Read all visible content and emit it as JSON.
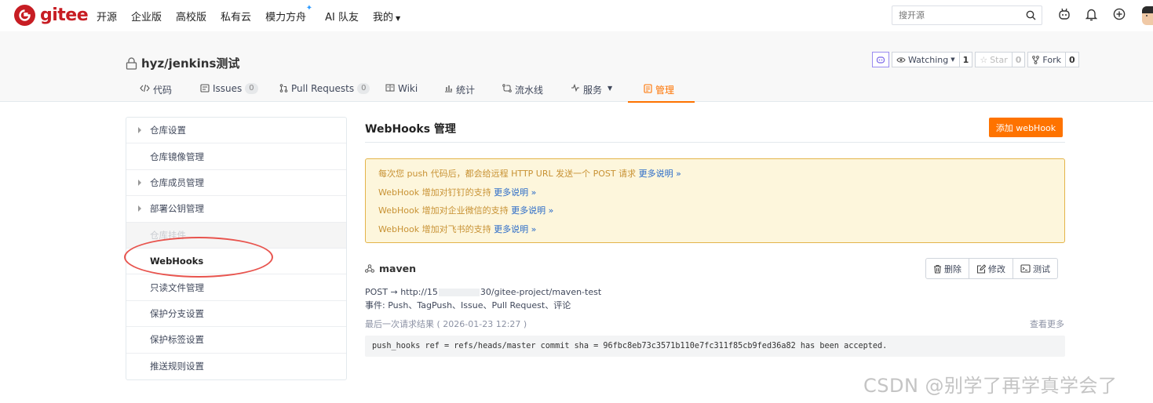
{
  "brand": {
    "name": "gitee",
    "color": "#c71d23",
    "accent": "#fe7300"
  },
  "topnav": {
    "links": [
      "开源",
      "企业版",
      "高校版",
      "私有云",
      "模力方舟",
      "AI 队友",
      "我的"
    ],
    "search_placeholder": "搜开源"
  },
  "project": {
    "title": "hyz/jenkins测试",
    "watch_label": "Watching",
    "watch_count": "1",
    "star_label": "Star",
    "star_count": "0",
    "fork_label": "Fork",
    "fork_count": "0",
    "tabs": [
      {
        "label": "代码"
      },
      {
        "label": "Issues",
        "badge": "0"
      },
      {
        "label": "Pull Requests",
        "badge": "0"
      },
      {
        "label": "Wiki"
      },
      {
        "label": "统计"
      },
      {
        "label": "流水线"
      },
      {
        "label": "服务"
      },
      {
        "label": "管理"
      }
    ]
  },
  "sidebar": {
    "items": [
      "仓库设置",
      "仓库镜像管理",
      "仓库成员管理",
      "部署公钥管理",
      "仓库挂件",
      "WebHooks",
      "只读文件管理",
      "保护分支设置",
      "保护标签设置",
      "推送规则设置"
    ]
  },
  "main": {
    "title": "WebHooks 管理",
    "add_button": "添加 webHook",
    "notice": [
      {
        "text": "每次您 push 代码后，都会给远程 HTTP URL 发送一个 POST 请求",
        "more": "更多说明 »"
      },
      {
        "text": "WebHook 增加对钉钉的支持",
        "more": "更多说明 »"
      },
      {
        "text": "WebHook 增加对企业微信的支持",
        "more": "更多说明 »"
      },
      {
        "text": "WebHook 增加对飞书的支持",
        "more": "更多说明 »"
      }
    ],
    "hook": {
      "name": "maven",
      "delete": "删除",
      "edit": "修改",
      "test": "测试",
      "url_prefix": "POST → http://15",
      "url_suffix": "30/gitee-project/maven-test",
      "events": "事件:  Push、TagPush、Issue、Pull Request、评论",
      "last_result": "最后一次请求结果 ( 2026-01-23 12:27 )",
      "see_more": "查看更多",
      "response": "push_hooks ref = refs/heads/master commit sha = 96fbc8eb73c3571b110e7fc311f85cb9fed36a82 has been accepted."
    }
  },
  "watermark": "CSDN @别学了再学真学会了"
}
